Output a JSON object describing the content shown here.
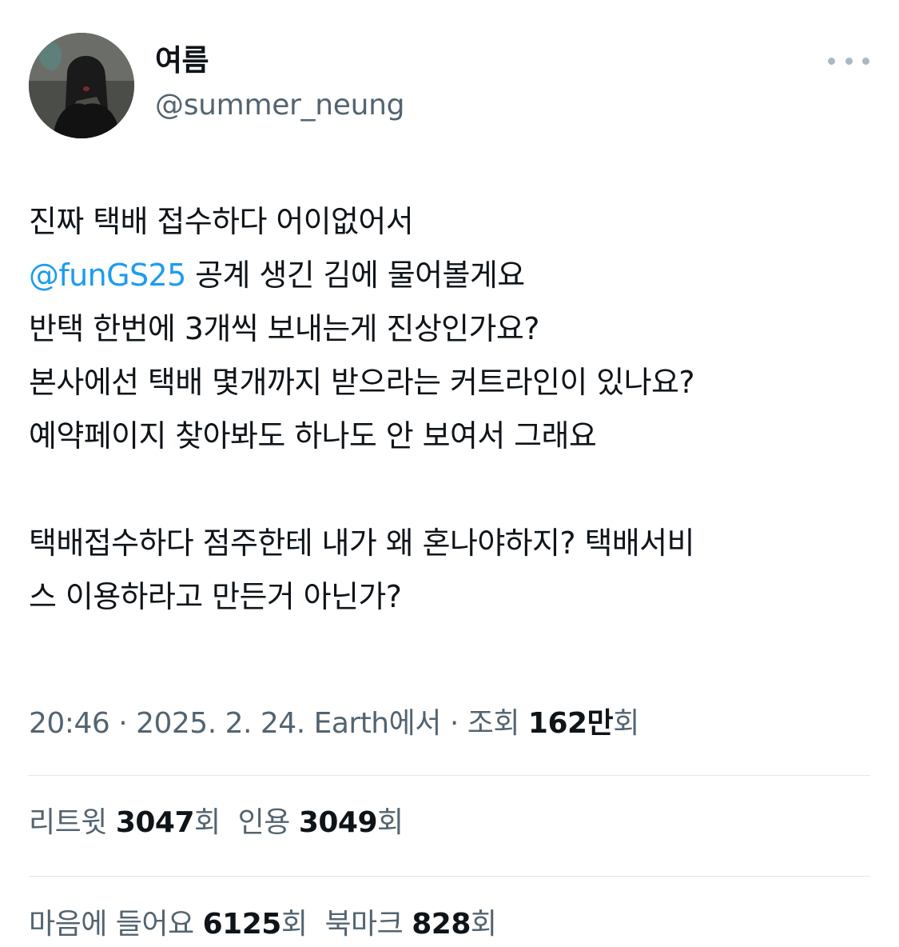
{
  "author": {
    "display_name": "여름",
    "handle": "@summer_neung"
  },
  "tweet": {
    "lines": [
      "진짜 택배 접수하다 어이없어서",
      "공계 생긴 김에 물어볼게요",
      "반택 한번에 3개씩 보내는게 진상인가요?",
      "본사에선 택배 몇개까지 받으라는 커트라인이 있나요?",
      "예약페이지 찾아봐도 하나도 안 보여서 그래요",
      "택배접수하다 점주한테 내가 왜 혼나야하지? 택배서비",
      "스 이용하라고 만든거 아닌가?"
    ],
    "mention": "@funGS25"
  },
  "meta": {
    "time": "20:46",
    "sep1": " · ",
    "date": "2025. 2. 24.",
    "source": " Earth에서",
    "sep2": " · ",
    "views_label": "조회 ",
    "views_count": "162만",
    "views_suffix": "회"
  },
  "stats_row1": {
    "retweets_label": "리트윗 ",
    "retweets_count": "3047",
    "retweets_suffix": "회",
    "quotes_label": "인용 ",
    "quotes_count": "3049",
    "quotes_suffix": "회"
  },
  "stats_row2": {
    "likes_label": "마음에 들어요 ",
    "likes_count": "6125",
    "likes_suffix": "회",
    "bookmarks_label": "북마크 ",
    "bookmarks_count": "828",
    "bookmarks_suffix": "회"
  },
  "colors": {
    "link": "#1d9bf0",
    "secondary_text": "#536471",
    "primary_text": "#0f1419",
    "divider": "#e3e7ea"
  },
  "icons": {
    "more": "more-horizontal-icon"
  }
}
